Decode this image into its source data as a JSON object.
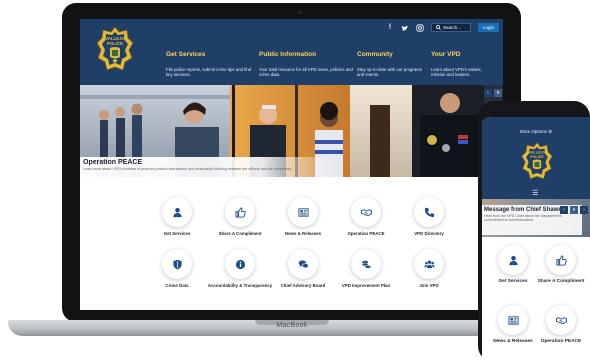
{
  "site": {
    "top_bar": {
      "social": [
        {
          "name": "facebook-icon",
          "glyph": "f"
        },
        {
          "name": "twitter-icon",
          "glyph": "🐦"
        },
        {
          "name": "instagram-icon",
          "glyph": "◎"
        }
      ],
      "search_label": "Search...",
      "login_label": "Login"
    },
    "badge_text": {
      "top": "VALLEJO",
      "mid": "POLICE"
    },
    "nav": [
      {
        "title": "Get Services",
        "desc": "File police reports, submit crime tips and find key services."
      },
      {
        "title": "Public Information",
        "desc": "Your total resource for all VPD news, policies and crime data."
      },
      {
        "title": "Community",
        "desc": "Stay up-to-date with our programs and events."
      },
      {
        "title": "Your VPD",
        "desc": "Learn about VPD's values, mission and leaders."
      }
    ],
    "hero": {
      "title": "Operation PEACE",
      "subtitle": "Learn more about VPD's initiative to promote positive interactions and relationship building between the officers and the community.",
      "controls": [
        "‹",
        "⏸",
        "›"
      ]
    },
    "quick_links": [
      {
        "label": "Get Services",
        "icon": "user-icon"
      },
      {
        "label": "Share A Compliment",
        "icon": "thumbs-up-icon"
      },
      {
        "label": "News & Releases",
        "icon": "newspaper-icon"
      },
      {
        "label": "Operation PEACE",
        "icon": "handshake-icon"
      },
      {
        "label": "VPD Directory",
        "icon": "phone-icon"
      },
      {
        "label": "Crime Data",
        "icon": "shield-icon"
      },
      {
        "label": "Accountability & Transparency",
        "icon": "info-icon"
      },
      {
        "label": "Chief Advisory Board",
        "icon": "chat-icon"
      },
      {
        "label": "VPD Improvement Plan",
        "icon": "coins-icon"
      },
      {
        "label": "Join VPD",
        "icon": "group-icon"
      }
    ],
    "colors": {
      "header": "#1f3f68",
      "accent": "#ffd15a",
      "icon": "#1f4f86"
    }
  },
  "laptop": {
    "brand": "MacBook"
  },
  "phone": {
    "more_options": "More Options",
    "menu_glyph": "☰",
    "hero": {
      "title": "Message from Chief Shawny",
      "subtitle": "Hear from the VPD Chief about the Department's commitment to communication.",
      "controls": [
        "‹",
        "⏸",
        "›"
      ]
    },
    "quick_links": [
      {
        "label": "Get Services"
      },
      {
        "label": "Share A Compliment"
      },
      {
        "label": "News & Releases"
      },
      {
        "label": "Operation PEACE"
      }
    ]
  }
}
